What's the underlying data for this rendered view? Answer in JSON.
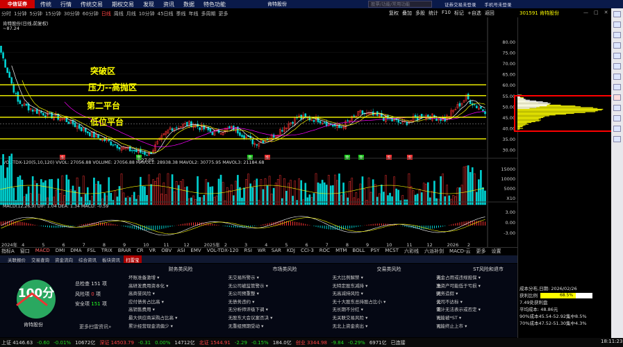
{
  "app": {
    "logo_text": "中信证券",
    "menu": [
      "传统",
      "行情",
      "传统交易",
      "期权交易",
      "发现",
      "资讯",
      "数据",
      "特色功能"
    ],
    "window_title": "肯特股份",
    "search_placeholder": "股票/功能/常用功能",
    "top_right": [
      "证券交易未登录",
      "手机号未登录"
    ]
  },
  "period_bar": {
    "items": [
      "分时",
      "1分钟",
      "5分钟",
      "15分钟",
      "30分钟",
      "60分钟",
      "日线",
      "周线",
      "月线",
      "10分钟",
      "45日线",
      "季线",
      "年线",
      "多周期",
      "更多"
    ],
    "active": "日线"
  },
  "toolbar": {
    "items": [
      "复权",
      "叠加",
      "多股",
      "统计",
      "F10",
      "标记",
      "+自选",
      "返回"
    ]
  },
  "stock": {
    "code_name": "301591 肯特股份"
  },
  "chart": {
    "title": "肯特股份(日线,前复权)",
    "max_label": "~87.24",
    "min_label": "←27.05",
    "annotations": [
      "突破区",
      "压力--高抛区",
      "第二平台",
      "低位平台"
    ],
    "y_ticks": [
      "80.00",
      "75.00",
      "70.00",
      "65.00",
      "60.00",
      "55.00",
      "50.00",
      "45.00",
      "40.00",
      "35.00",
      "30.00"
    ],
    "x_ticks": [
      "2024年",
      "4",
      "5",
      "6",
      "7",
      "8",
      "9",
      "10",
      "11",
      "12",
      "2025年",
      "2",
      "3",
      "4",
      "5",
      "6",
      "7",
      "8",
      "9",
      "10",
      "11",
      "12",
      "2026",
      "2"
    ],
    "signal_marks": [
      "S",
      "B",
      "B",
      "S",
      "B",
      "B",
      "S",
      "S"
    ]
  },
  "volume": {
    "label_line": "VOL-TDX-120(5,10,120) VVOL: 27056.88 VOLUME: 27056.88 MAVOL1: 28938.38 MAVOL2: 30775.95 MAVOL3: 21184.68",
    "y_ticks": [
      "15000",
      "10000",
      "5000",
      "X10"
    ]
  },
  "macd": {
    "label_line": "MACD(12,26,9) DIF: 1.04 DEA: 1.34 MACD: -0.59",
    "y_ticks": [
      "3.00",
      "0.00",
      "-3.00"
    ]
  },
  "bottom_tabs": {
    "items": [
      "指标A",
      "窗口",
      "MACD",
      "DMI",
      "DMA",
      "FSL",
      "TRIX",
      "BRAR",
      "CR",
      "VR",
      "OBV",
      "ASI",
      "EMV",
      "VOL-TDX-120",
      "RSI",
      "WR",
      "SAR",
      "KDJ",
      "CCI-3",
      "ROC",
      "MTM",
      "BOLL",
      "PSY",
      "MCST",
      "六彩线",
      "六派补剑",
      "MACD-云",
      "更多",
      "设置"
    ],
    "selected": "MACD"
  },
  "info_tabs": {
    "items": [
      "关联报价",
      "交易查询",
      "资金流向",
      "综合资讯",
      "板块资讯",
      "扫雷宝"
    ],
    "selected": "扫雷宝"
  },
  "risk": {
    "score": "100分",
    "stock_name": "肯特股份",
    "stats": [
      {
        "label": "总检查",
        "value": "151",
        "unit": "项"
      },
      {
        "label": "风险项",
        "value": "0",
        "unit": "项"
      },
      {
        "label": "安全项",
        "value": "151",
        "unit": "项"
      }
    ],
    "more_link": "更多扫雷资讯»",
    "columns": [
      {
        "title": "财务类风险",
        "items": [
          "坏账准备激增",
          "高研发费用资本化",
          "高商誉风险",
          "应付债务占比高",
          "高销售费用",
          "最大供应商采购占比高",
          "累计经营现金流偏少"
        ]
      },
      {
        "title": "市场类风险",
        "items": [
          "交易所警示",
          "公司被监管警示",
          "公司预重整",
          "债务违约",
          "分析师评级下调",
          "股东大会议案否决",
          "重组预期受动"
        ]
      },
      {
        "title": "交易类风险",
        "items": [
          "大比例解禁",
          "特定股东减持",
          "高减持风险",
          "十大股东总持股占比小",
          "长期不分红",
          "关联交易风险",
          "北上资金卖出"
        ]
      },
      {
        "title": "ST风险和退市",
        "items": [
          "资金占用或违规担保",
          "净资产可能低于亏损",
          "财务造假",
          "公司不达标",
          "审计无法表示或否定",
          "可能被*ST",
          "可能终止上市"
        ]
      }
    ],
    "none_label": "无"
  },
  "chip": {
    "date_line": "成本分布,日期: 2026/02/26",
    "profit_ratio_label": "获利比例",
    "profit_ratio": "68.5%",
    "profit_ratio_value": 0.685,
    "profit_line": "7.49处获利盘",
    "avg_cost": "平均成本: 48.86元",
    "range90": "90%成本45.54-52.92集中8.5%",
    "range70": "70%成本47.52-51.30集中4.3%"
  },
  "status": {
    "items": [
      {
        "text": "上证 4146.63",
        "color": "white"
      },
      {
        "text": "-0.60",
        "color": "green"
      },
      {
        "text": "-0.01%",
        "color": "green"
      },
      {
        "text": "10672亿",
        "color": "white"
      },
      {
        "text": "深证 14503.79",
        "color": "red"
      },
      {
        "text": "-0.31",
        "color": "green"
      },
      {
        "text": "0.00%",
        "color": "green"
      },
      {
        "text": "14712亿",
        "color": "white"
      },
      {
        "text": "北证 1544.91",
        "color": "red"
      },
      {
        "text": "-2.29",
        "color": "green"
      },
      {
        "text": "-0.15%",
        "color": "green"
      },
      {
        "text": "184.0亿",
        "color": "white"
      },
      {
        "text": "创业 3344.98",
        "color": "red"
      },
      {
        "text": "-9.84",
        "color": "green"
      },
      {
        "text": "-0.29%",
        "color": "green"
      },
      {
        "text": "6971亿",
        "color": "white"
      },
      {
        "text": "已连接",
        "color": "white"
      }
    ],
    "time": "18:11:23"
  },
  "sidebar_icons": [
    "hand-icon",
    "grid-icon",
    "kline-icon",
    "list-icon",
    "chart-icon",
    "news-icon",
    "fund-icon",
    "rank-icon",
    "star-icon",
    "settings-icon",
    "chat-icon",
    "book-icon",
    "tool-icon"
  ],
  "colors": {
    "up": "#ff3333",
    "down": "#00d0d0",
    "level_line": "#ffff00",
    "score_green": "#2aa860"
  }
}
